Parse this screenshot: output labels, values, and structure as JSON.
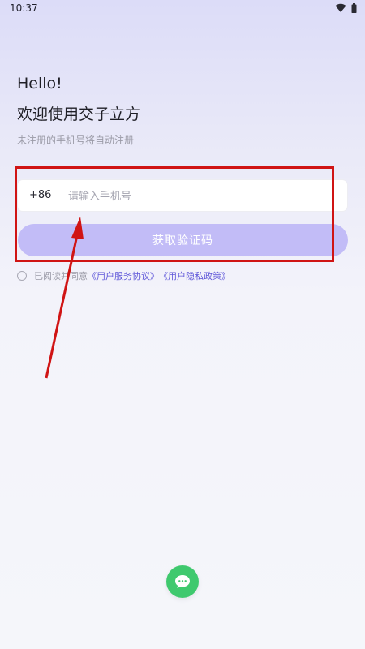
{
  "status_bar": {
    "time": "10:37",
    "icons": [
      "wifi-icon",
      "battery-icon"
    ]
  },
  "header": {
    "greeting": "Hello!",
    "welcome": "欢迎使用交子立方",
    "subtitle": "未注册的手机号将自动注册"
  },
  "login_form": {
    "country_code": "+86",
    "phone_placeholder": "请输入手机号",
    "phone_value": "",
    "get_code_label": "获取验证码"
  },
  "agreement": {
    "checked": false,
    "prefix": "已阅读并同意",
    "service_link": "《用户服务协议》",
    "privacy_link": "《用户隐私政策》"
  },
  "floating": {
    "chat_icon": "chat-bubble-icon"
  },
  "colors": {
    "accent": "#c2bcf7",
    "link": "#5f57d9",
    "chat": "#3fc96e",
    "annotation": "#d01414"
  }
}
